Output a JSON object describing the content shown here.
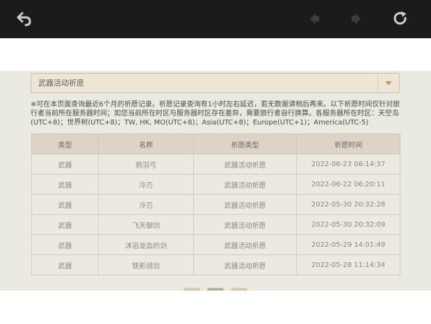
{
  "banner": {
    "select_value": "武器活动祈愿"
  },
  "notice": "※可在本页面查询最近6个月的祈愿记录。祈愿记录查询有1小时左右延迟，若无数据请稍后再来。以下祈愿时间仅针对旅行者当前所在服务器时间；如您当前所在时区与服务器时区存在差异，需要旅行者自行换算。各服务器所在时区：天空岛(UTC+8)；世界树(UTC+8)；TW, HK, MO(UTC+8)；Asia(UTC+8)；Europe(UTC+1)；America(UTC-5)",
  "table": {
    "headers": [
      "类型",
      "名称",
      "祈愿类型",
      "祈愿时间"
    ],
    "rows": [
      [
        "武器",
        "鸦羽弓",
        "武器活动祈愿",
        "2022-06-23 06:14:37"
      ],
      [
        "武器",
        "冷刃",
        "武器活动祈愿",
        "2022-06-22 06:20:11"
      ],
      [
        "武器",
        "冷刃",
        "武器活动祈愿",
        "2022-05-30 20:32:28"
      ],
      [
        "武器",
        "飞天御剑",
        "武器活动祈愿",
        "2022-05-30 20:32:09"
      ],
      [
        "武器",
        "沐浴龙血的剑",
        "武器活动祈愿",
        "2022-05-29 14:01:49"
      ],
      [
        "武器",
        "铁影阔剑",
        "武器活动祈愿",
        "2022-05-28 11:14:34"
      ]
    ]
  },
  "colors": {
    "topbar": "#1b1b1b",
    "accent_gold": "#c29a5a",
    "content_bg": "#ece9e3"
  },
  "icons": {
    "back": "back-arrow-icon",
    "prev": "prev-icon",
    "next": "next-icon",
    "reload": "reload-icon",
    "dropdown": "chevron-down-icon"
  }
}
